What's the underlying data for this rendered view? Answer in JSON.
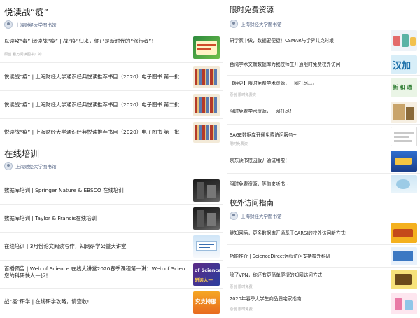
{
  "left": {
    "section1": {
      "title": "悦读战“疫”",
      "account": "上海财经大学图书馆",
      "articles": [
        {
          "title": "以读攻“毒” 阅读战“疫” | 战“疫”归来，你已是新时代的“修行者”！",
          "meta": "原创 看万阅读图书厂的"
        },
        {
          "title": "悦读战“疫” | 上海财经大学通识经典悦读推荐书目（2020）电子图书 第一批",
          "meta": ""
        },
        {
          "title": "悦读战“疫” | 上海财经大学通识经典悦读推荐书目（2020）电子图书 第二批",
          "meta": ""
        },
        {
          "title": "悦读战“疫” | 上海财经大学通识经典悦读推荐书目（2020）电子图书 第三批",
          "meta": ""
        }
      ]
    },
    "section2": {
      "title": "在线培训",
      "account": "上海财经大学图书馆",
      "articles": [
        {
          "title": "数据库培训 | Springer Nature & EBSCO 在线培训",
          "meta": ""
        },
        {
          "title": "数据库培训 | Taylor & Francis在线培训",
          "meta": ""
        },
        {
          "title": "在线培训 | 3月份论文阅读写作，知网研学公益大讲堂",
          "meta": ""
        },
        {
          "title": "首播预告 | Web of Science 在线大讲堂2020春季课程第一讲：Web of Science，让",
          "title2": "您的科研快人一步！",
          "meta": ""
        },
        {
          "title": "战“疫”研学 | 在线研学攻略，请查收!",
          "meta": ""
        }
      ],
      "thumb_texts": {
        "t3": "of Science",
        "t3b": "研读人一",
        "t4": "究支持服"
      }
    }
  },
  "right": {
    "section1": {
      "title": "限时免费资源",
      "account": "上海财经大学图书馆",
      "articles": [
        {
          "title": "研学家中做，数据要便捷！CSMAR与学界共克时艰！",
          "meta": ""
        },
        {
          "title": "台湾学术文献数据库为我校师生开通限时免费校外访问",
          "meta": ""
        },
        {
          "title": "【续更】限时免费学术资源，一网打尽。。。",
          "meta": "原创 限时免费资"
        },
        {
          "title": "限时免费学术资源，一网打尽！",
          "meta": ""
        },
        {
          "title": "SAGE数据库开通免费访问服务~",
          "meta": "限时免费资"
        },
        {
          "title": "京东读书校园版开通试用啦！",
          "meta": ""
        },
        {
          "title": "限时免费资源，等你来听书~",
          "meta": ""
        }
      ],
      "thumb_texts": {
        "t2": "汉加",
        "t3": "新 和 通"
      }
    },
    "section2": {
      "title": "校外访问指南",
      "account": "上海财经大学图书馆",
      "articles": [
        {
          "title": "继知网后，更多数据库开通基于CARSI的校外访问新方式!",
          "meta": ""
        },
        {
          "title": "功能推介 | ScienceDirect远程访问支持校外科研",
          "meta": ""
        },
        {
          "title": "除了VPN，你还有更简单便捷的知网访问方式!",
          "meta": "原创 限时免费"
        },
        {
          "title": "2020年春季大学生商品质宅家指南",
          "meta": "原创 限时免费"
        }
      ]
    }
  }
}
